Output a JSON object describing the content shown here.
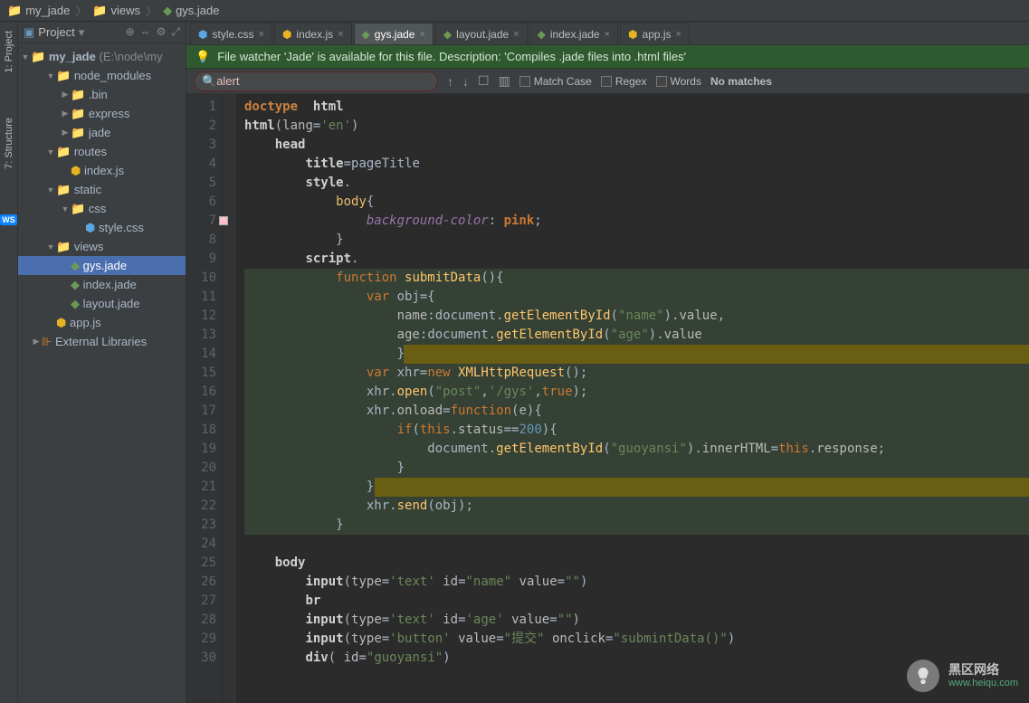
{
  "breadcrumb": [
    "my_jade",
    "views",
    "gys.jade"
  ],
  "leftStrip": {
    "project": "1: Project",
    "structure": "7: Structure",
    "ws": "WS"
  },
  "sidebar": {
    "title": "Project",
    "root": "my_jade",
    "rootPath": "(E:\\node\\my",
    "items": [
      {
        "indent": 1,
        "arrow": "▼",
        "icon": "folder",
        "label": "node_modules"
      },
      {
        "indent": 2,
        "arrow": "▶",
        "icon": "folder",
        "label": ".bin"
      },
      {
        "indent": 2,
        "arrow": "▶",
        "icon": "folder",
        "label": "express"
      },
      {
        "indent": 2,
        "arrow": "▶",
        "icon": "folder",
        "label": "jade"
      },
      {
        "indent": 1,
        "arrow": "▼",
        "icon": "folder",
        "label": "routes"
      },
      {
        "indent": 2,
        "arrow": "",
        "icon": "js",
        "label": "index.js"
      },
      {
        "indent": 1,
        "arrow": "▼",
        "icon": "folder",
        "label": "static"
      },
      {
        "indent": 2,
        "arrow": "▼",
        "icon": "folder",
        "label": "css"
      },
      {
        "indent": 3,
        "arrow": "",
        "icon": "css",
        "label": "style.css"
      },
      {
        "indent": 1,
        "arrow": "▼",
        "icon": "folder",
        "label": "views"
      },
      {
        "indent": 2,
        "arrow": "",
        "icon": "jade",
        "label": "gys.jade",
        "sel": true
      },
      {
        "indent": 2,
        "arrow": "",
        "icon": "jade",
        "label": "index.jade"
      },
      {
        "indent": 2,
        "arrow": "",
        "icon": "jade",
        "label": "layout.jade"
      },
      {
        "indent": 1,
        "arrow": "",
        "icon": "js",
        "label": "app.js"
      },
      {
        "indent": 0,
        "arrow": "▶",
        "icon": "lib",
        "label": "External Libraries"
      }
    ]
  },
  "tabs": [
    {
      "icon": "css",
      "label": "style.css",
      "close": true
    },
    {
      "icon": "js",
      "label": "index.js",
      "close": true
    },
    {
      "icon": "jade",
      "label": "gys.jade",
      "close": true,
      "active": true
    },
    {
      "icon": "jade",
      "label": "layout.jade",
      "close": true
    },
    {
      "icon": "jade",
      "label": "index.jade",
      "close": true
    },
    {
      "icon": "js",
      "label": "app.js",
      "close": true
    }
  ],
  "notice": "File watcher 'Jade' is available for this file. Description: 'Compiles .jade files into .html files'",
  "search": {
    "value": "alert",
    "matchCase": "Match Case",
    "regex": "Regex",
    "words": "Words",
    "noMatches": "No matches"
  },
  "code": {
    "lines": [
      {
        "n": 1,
        "segs": [
          [
            "doctype",
            "doctype  "
          ],
          [
            "htmltag",
            "html"
          ]
        ]
      },
      {
        "n": 2,
        "segs": [
          [
            "htmltag",
            "html"
          ],
          [
            "punct",
            "("
          ],
          [
            "attr",
            "lang"
          ],
          [
            "punct",
            "="
          ],
          [
            "str",
            "'en'"
          ],
          [
            "punct",
            ")"
          ]
        ]
      },
      {
        "n": 3,
        "segs": [
          [
            "sp",
            "    "
          ],
          [
            "htmltag",
            "head"
          ]
        ]
      },
      {
        "n": 4,
        "segs": [
          [
            "sp",
            "        "
          ],
          [
            "htmltag",
            "title"
          ],
          [
            "punct",
            "="
          ],
          [
            "val",
            "pageTitle"
          ]
        ]
      },
      {
        "n": 5,
        "segs": [
          [
            "sp",
            "        "
          ],
          [
            "htmltag",
            "style"
          ],
          [
            "punct",
            "."
          ]
        ]
      },
      {
        "n": 6,
        "segs": [
          [
            "sp",
            "            "
          ],
          [
            "tag",
            "body"
          ],
          [
            "punct",
            "{"
          ]
        ]
      },
      {
        "n": 7,
        "mark": "pink",
        "segs": [
          [
            "sp",
            "                "
          ],
          [
            "css-prop",
            "background-color"
          ],
          [
            "punct",
            ": "
          ],
          [
            "css-val",
            "pink"
          ],
          [
            "punct",
            ";"
          ]
        ]
      },
      {
        "n": 8,
        "segs": [
          [
            "sp",
            "            "
          ],
          [
            "punct",
            "}"
          ]
        ]
      },
      {
        "n": 9,
        "segs": [
          [
            "sp",
            "        "
          ],
          [
            "htmltag",
            "script"
          ],
          [
            "punct",
            "."
          ]
        ]
      },
      {
        "n": 10,
        "bg": "dg",
        "segs": [
          [
            "sp",
            "            "
          ],
          [
            "kw-orange",
            "function "
          ],
          [
            "fn",
            "submitData"
          ],
          [
            "punct",
            "(){"
          ]
        ]
      },
      {
        "n": 11,
        "bg": "dg",
        "segs": [
          [
            "sp",
            "                "
          ],
          [
            "kw-orange",
            "var "
          ],
          [
            "val",
            "obj"
          ],
          [
            "punct",
            "={"
          ]
        ]
      },
      {
        "n": 12,
        "bg": "dg",
        "segs": [
          [
            "sp",
            "                    "
          ],
          [
            "attr",
            "name"
          ],
          [
            "punct",
            ":"
          ],
          [
            "val",
            "document"
          ],
          [
            "punct",
            "."
          ],
          [
            "fn",
            "getElementById"
          ],
          [
            "punct",
            "("
          ],
          [
            "str",
            "\"name\""
          ],
          [
            "punct",
            ")."
          ],
          [
            "attr",
            "value"
          ],
          [
            "punct",
            ","
          ]
        ]
      },
      {
        "n": 13,
        "bg": "dg",
        "segs": [
          [
            "sp",
            "                    "
          ],
          [
            "attr",
            "age"
          ],
          [
            "punct",
            ":"
          ],
          [
            "val",
            "document"
          ],
          [
            "punct",
            "."
          ],
          [
            "fn",
            "getElementById"
          ],
          [
            "punct",
            "("
          ],
          [
            "str",
            "\"age\""
          ],
          [
            "punct",
            ")."
          ],
          [
            "attr",
            "value"
          ]
        ]
      },
      {
        "n": 14,
        "bg": "dg",
        "olive": true,
        "segs": [
          [
            "sp",
            "                    "
          ],
          [
            "punct",
            "}"
          ]
        ]
      },
      {
        "n": 15,
        "bg": "dg",
        "segs": [
          [
            "sp",
            "                "
          ],
          [
            "kw-orange",
            "var "
          ],
          [
            "val",
            "xhr"
          ],
          [
            "punct",
            "="
          ],
          [
            "kw-orange",
            "new "
          ],
          [
            "type-y",
            "XMLHttpRequest"
          ],
          [
            "punct",
            "();"
          ]
        ]
      },
      {
        "n": 16,
        "bg": "dg",
        "segs": [
          [
            "sp",
            "                "
          ],
          [
            "val",
            "xhr"
          ],
          [
            "punct",
            "."
          ],
          [
            "fn",
            "open"
          ],
          [
            "punct",
            "("
          ],
          [
            "str",
            "\"post\""
          ],
          [
            "punct",
            ","
          ],
          [
            "str",
            "'/gys'"
          ],
          [
            "punct",
            ","
          ],
          [
            "kw-orange",
            "true"
          ],
          [
            "punct",
            ");"
          ]
        ]
      },
      {
        "n": 17,
        "bg": "dg",
        "segs": [
          [
            "sp",
            "                "
          ],
          [
            "val",
            "xhr"
          ],
          [
            "punct",
            "."
          ],
          [
            "attr",
            "onload"
          ],
          [
            "punct",
            "="
          ],
          [
            "kw-orange",
            "function"
          ],
          [
            "punct",
            "("
          ],
          [
            "val",
            "e"
          ],
          [
            "punct",
            "){"
          ]
        ]
      },
      {
        "n": 18,
        "bg": "dg",
        "segs": [
          [
            "sp",
            "                    "
          ],
          [
            "kw-orange",
            "if"
          ],
          [
            "punct",
            "("
          ],
          [
            "kw-orange",
            "this"
          ],
          [
            "punct",
            "."
          ],
          [
            "attr",
            "status"
          ],
          [
            "punct",
            "=="
          ],
          [
            "num",
            "200"
          ],
          [
            "punct",
            "){"
          ]
        ]
      },
      {
        "n": 19,
        "bg": "dg",
        "segs": [
          [
            "sp",
            "                        "
          ],
          [
            "val",
            "document"
          ],
          [
            "punct",
            "."
          ],
          [
            "fn",
            "getElementById"
          ],
          [
            "punct",
            "("
          ],
          [
            "str",
            "\"guoyansi\""
          ],
          [
            "punct",
            ")."
          ],
          [
            "attr",
            "innerHTML"
          ],
          [
            "punct",
            "="
          ],
          [
            "kw-orange",
            "this"
          ],
          [
            "punct",
            "."
          ],
          [
            "attr",
            "response"
          ],
          [
            "punct",
            ";"
          ]
        ]
      },
      {
        "n": 20,
        "bg": "dg",
        "segs": [
          [
            "sp",
            "                    "
          ],
          [
            "punct",
            "}"
          ]
        ]
      },
      {
        "n": 21,
        "bg": "dg",
        "olive": true,
        "segs": [
          [
            "sp",
            "                "
          ],
          [
            "punct",
            "}"
          ]
        ]
      },
      {
        "n": 22,
        "bg": "dg",
        "segs": [
          [
            "sp",
            "                "
          ],
          [
            "val",
            "xhr"
          ],
          [
            "punct",
            "."
          ],
          [
            "fn",
            "send"
          ],
          [
            "punct",
            "("
          ],
          [
            "val",
            "obj"
          ],
          [
            "punct",
            ");"
          ]
        ]
      },
      {
        "n": 23,
        "bg": "dg",
        "segs": [
          [
            "sp",
            "            "
          ],
          [
            "punct",
            "}"
          ]
        ]
      },
      {
        "n": 24,
        "segs": [
          [
            "sp",
            " "
          ]
        ]
      },
      {
        "n": 25,
        "segs": [
          [
            "sp",
            "    "
          ],
          [
            "htmltag",
            "body"
          ]
        ]
      },
      {
        "n": 26,
        "segs": [
          [
            "sp",
            "        "
          ],
          [
            "htmltag",
            "input"
          ],
          [
            "punct",
            "("
          ],
          [
            "attr",
            "type"
          ],
          [
            "punct",
            "="
          ],
          [
            "str",
            "'text'"
          ],
          [
            "punct",
            " "
          ],
          [
            "attr",
            "id"
          ],
          [
            "punct",
            "="
          ],
          [
            "str",
            "\"name\""
          ],
          [
            "punct",
            " "
          ],
          [
            "attr",
            "value"
          ],
          [
            "punct",
            "="
          ],
          [
            "str",
            "\"\""
          ],
          [
            "punct",
            ")"
          ]
        ]
      },
      {
        "n": 27,
        "segs": [
          [
            "sp",
            "        "
          ],
          [
            "htmltag",
            "br"
          ]
        ]
      },
      {
        "n": 28,
        "segs": [
          [
            "sp",
            "        "
          ],
          [
            "htmltag",
            "input"
          ],
          [
            "punct",
            "("
          ],
          [
            "attr",
            "type"
          ],
          [
            "punct",
            "="
          ],
          [
            "str",
            "'text'"
          ],
          [
            "punct",
            " "
          ],
          [
            "attr",
            "id"
          ],
          [
            "punct",
            "="
          ],
          [
            "str",
            "'age'"
          ],
          [
            "punct",
            " "
          ],
          [
            "attr",
            "value"
          ],
          [
            "punct",
            "="
          ],
          [
            "str",
            "\"\""
          ],
          [
            "punct",
            ")"
          ]
        ]
      },
      {
        "n": 29,
        "segs": [
          [
            "sp",
            "        "
          ],
          [
            "htmltag",
            "input"
          ],
          [
            "punct",
            "("
          ],
          [
            "attr",
            "type"
          ],
          [
            "punct",
            "="
          ],
          [
            "str",
            "'button'"
          ],
          [
            "punct",
            " "
          ],
          [
            "attr",
            "value"
          ],
          [
            "punct",
            "="
          ],
          [
            "str",
            "\"提交\""
          ],
          [
            "punct",
            " "
          ],
          [
            "attr",
            "onclick"
          ],
          [
            "punct",
            "="
          ],
          [
            "str",
            "\"submintData()\""
          ],
          [
            "punct",
            ")"
          ]
        ]
      },
      {
        "n": 30,
        "segs": [
          [
            "sp",
            "        "
          ],
          [
            "htmltag",
            "div"
          ],
          [
            "punct",
            "( "
          ],
          [
            "attr",
            "id"
          ],
          [
            "punct",
            "="
          ],
          [
            "str",
            "\"guoyansi\""
          ],
          [
            "punct",
            ")"
          ]
        ]
      }
    ]
  },
  "watermark": {
    "t1": "黑区网络",
    "t2": "www.heiqu.com"
  }
}
